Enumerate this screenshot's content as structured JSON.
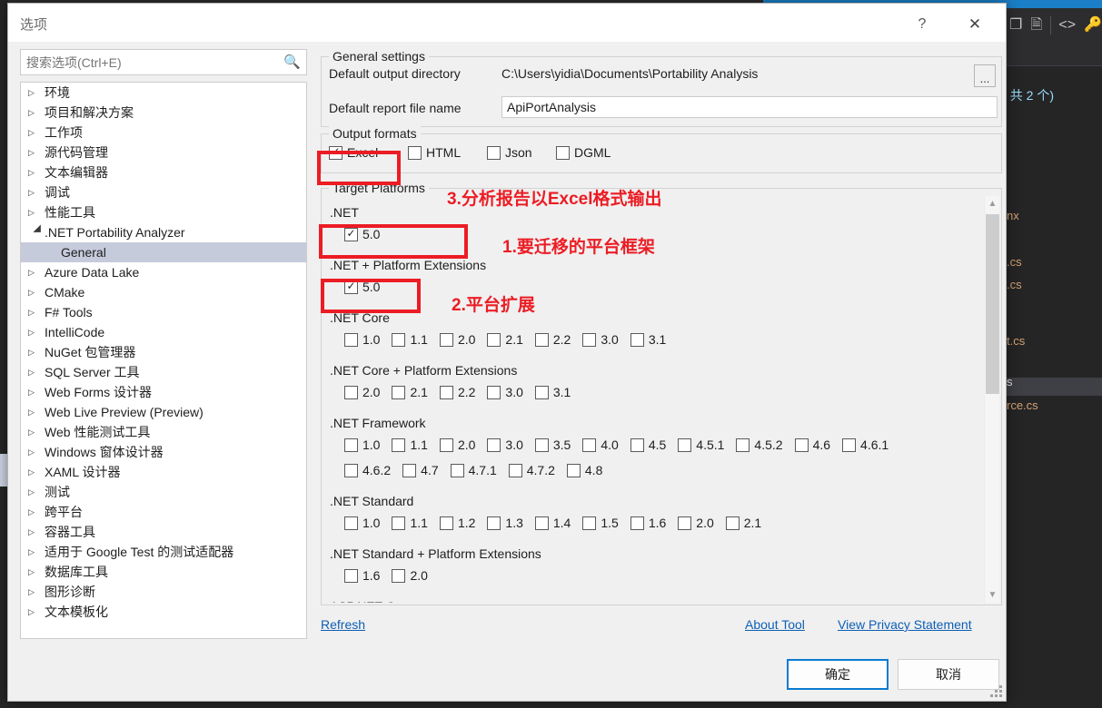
{
  "background": {
    "toolbar_icons": [
      "window-restore-icon",
      "copy-icon",
      "code-brackets-icon",
      "key-icon"
    ],
    "solution_count_text": ", 共 2 个)",
    "files": [
      "nx",
      ".cs",
      ".cs",
      "t.cs",
      "s",
      "rce.cs"
    ]
  },
  "dialog": {
    "title": "选项",
    "help_icon": "?",
    "close_icon": "✕"
  },
  "search": {
    "placeholder": "搜索选项(Ctrl+E)",
    "value": "",
    "icon": "search-icon"
  },
  "tree": {
    "items": [
      {
        "label": "环境",
        "level": 0,
        "expanded": false,
        "selected": false
      },
      {
        "label": "项目和解决方案",
        "level": 0,
        "expanded": false,
        "selected": false
      },
      {
        "label": "工作项",
        "level": 0,
        "expanded": false,
        "selected": false
      },
      {
        "label": "源代码管理",
        "level": 0,
        "expanded": false,
        "selected": false
      },
      {
        "label": "文本编辑器",
        "level": 0,
        "expanded": false,
        "selected": false
      },
      {
        "label": "调试",
        "level": 0,
        "expanded": false,
        "selected": false
      },
      {
        "label": "性能工具",
        "level": 0,
        "expanded": false,
        "selected": false
      },
      {
        "label": ".NET Portability Analyzer",
        "level": 0,
        "expanded": true,
        "selected": false
      },
      {
        "label": "General",
        "level": 1,
        "expanded": false,
        "selected": true
      },
      {
        "label": "Azure Data Lake",
        "level": 0,
        "expanded": false,
        "selected": false
      },
      {
        "label": "CMake",
        "level": 0,
        "expanded": false,
        "selected": false
      },
      {
        "label": "F# Tools",
        "level": 0,
        "expanded": false,
        "selected": false
      },
      {
        "label": "IntelliCode",
        "level": 0,
        "expanded": false,
        "selected": false
      },
      {
        "label": "NuGet 包管理器",
        "level": 0,
        "expanded": false,
        "selected": false
      },
      {
        "label": "SQL Server 工具",
        "level": 0,
        "expanded": false,
        "selected": false
      },
      {
        "label": "Web Forms 设计器",
        "level": 0,
        "expanded": false,
        "selected": false
      },
      {
        "label": "Web Live Preview (Preview)",
        "level": 0,
        "expanded": false,
        "selected": false
      },
      {
        "label": "Web 性能测试工具",
        "level": 0,
        "expanded": false,
        "selected": false
      },
      {
        "label": "Windows 窗体设计器",
        "level": 0,
        "expanded": false,
        "selected": false
      },
      {
        "label": "XAML 设计器",
        "level": 0,
        "expanded": false,
        "selected": false
      },
      {
        "label": "测试",
        "level": 0,
        "expanded": false,
        "selected": false
      },
      {
        "label": "跨平台",
        "level": 0,
        "expanded": false,
        "selected": false
      },
      {
        "label": "容器工具",
        "level": 0,
        "expanded": false,
        "selected": false
      },
      {
        "label": "适用于 Google Test 的测试适配器",
        "level": 0,
        "expanded": false,
        "selected": false
      },
      {
        "label": "数据库工具",
        "level": 0,
        "expanded": false,
        "selected": false
      },
      {
        "label": "图形诊断",
        "level": 0,
        "expanded": false,
        "selected": false
      },
      {
        "label": "文本模板化",
        "level": 0,
        "expanded": false,
        "selected": false
      }
    ]
  },
  "general_settings": {
    "legend": "General settings",
    "output_dir_label": "Default output directory",
    "output_dir_value": "C:\\Users\\yidia\\Documents\\Portability Analysis",
    "browse_button": "...",
    "report_name_label": "Default report file name",
    "report_name_value": "ApiPortAnalysis"
  },
  "output_formats": {
    "legend": "Output formats",
    "options": [
      {
        "label": "Excel",
        "checked": true
      },
      {
        "label": "HTML",
        "checked": false
      },
      {
        "label": "Json",
        "checked": false
      },
      {
        "label": "DGML",
        "checked": false
      }
    ]
  },
  "target_platforms": {
    "legend": "Target Platforms",
    "groups": [
      {
        "name": ".NET",
        "versions": [
          {
            "label": "5.0",
            "checked": true
          }
        ]
      },
      {
        "name": ".NET + Platform Extensions",
        "versions": [
          {
            "label": "5.0",
            "checked": true
          }
        ]
      },
      {
        "name": ".NET Core",
        "versions": [
          {
            "label": "1.0",
            "checked": false
          },
          {
            "label": "1.1",
            "checked": false
          },
          {
            "label": "2.0",
            "checked": false
          },
          {
            "label": "2.1",
            "checked": false
          },
          {
            "label": "2.2",
            "checked": false
          },
          {
            "label": "3.0",
            "checked": false
          },
          {
            "label": "3.1",
            "checked": false
          }
        ]
      },
      {
        "name": ".NET Core + Platform Extensions",
        "versions": [
          {
            "label": "2.0",
            "checked": false
          },
          {
            "label": "2.1",
            "checked": false
          },
          {
            "label": "2.2",
            "checked": false
          },
          {
            "label": "3.0",
            "checked": false
          },
          {
            "label": "3.1",
            "checked": false
          }
        ]
      },
      {
        "name": ".NET Framework",
        "versions": [
          {
            "label": "1.0",
            "checked": false
          },
          {
            "label": "1.1",
            "checked": false
          },
          {
            "label": "2.0",
            "checked": false
          },
          {
            "label": "3.0",
            "checked": false
          },
          {
            "label": "3.5",
            "checked": false
          },
          {
            "label": "4.0",
            "checked": false
          },
          {
            "label": "4.5",
            "checked": false
          },
          {
            "label": "4.5.1",
            "checked": false
          },
          {
            "label": "4.5.2",
            "checked": false
          },
          {
            "label": "4.6",
            "checked": false
          },
          {
            "label": "4.6.1",
            "checked": false
          },
          {
            "label": "4.6.2",
            "checked": false
          },
          {
            "label": "4.7",
            "checked": false
          },
          {
            "label": "4.7.1",
            "checked": false
          },
          {
            "label": "4.7.2",
            "checked": false
          },
          {
            "label": "4.8",
            "checked": false
          }
        ]
      },
      {
        "name": ".NET Standard",
        "versions": [
          {
            "label": "1.0",
            "checked": false
          },
          {
            "label": "1.1",
            "checked": false
          },
          {
            "label": "1.2",
            "checked": false
          },
          {
            "label": "1.3",
            "checked": false
          },
          {
            "label": "1.4",
            "checked": false
          },
          {
            "label": "1.5",
            "checked": false
          },
          {
            "label": "1.6",
            "checked": false
          },
          {
            "label": "2.0",
            "checked": false
          },
          {
            "label": "2.1",
            "checked": false
          }
        ]
      },
      {
        "name": ".NET Standard + Platform Extensions",
        "versions": [
          {
            "label": "1.6",
            "checked": false
          },
          {
            "label": "2.0",
            "checked": false
          }
        ]
      },
      {
        "name": "ASP.NET Core",
        "versions": []
      }
    ],
    "scrollbar": {
      "up_icon": "chevron-up-icon",
      "down_icon": "chevron-down-icon"
    }
  },
  "annotations": [
    {
      "id": "a1",
      "text": "1.要迁移的平台框架"
    },
    {
      "id": "a2",
      "text": "2.平台扩展"
    },
    {
      "id": "a3",
      "text": "3.分析报告以Excel格式输出"
    }
  ],
  "footer": {
    "refresh_link": "Refresh",
    "about_link": "About Tool",
    "privacy_link": "View Privacy Statement",
    "ok_button": "确定",
    "cancel_button": "取消"
  },
  "colors": {
    "annotation_red": "#ec1c24",
    "link_blue": "#0e5fb5",
    "selection": "#c6cbdc",
    "accent": "#0a7bd0"
  }
}
